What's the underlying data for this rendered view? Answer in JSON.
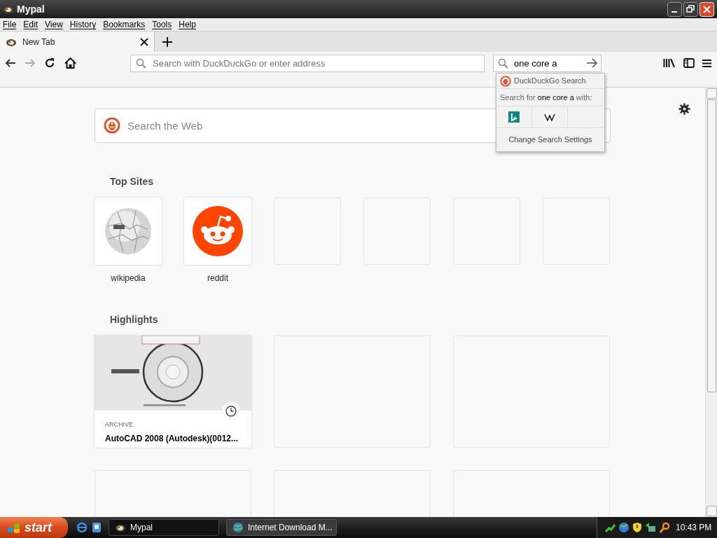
{
  "window": {
    "title": "Mypal"
  },
  "menu": [
    "File",
    "Edit",
    "View",
    "History",
    "Bookmarks",
    "Tools",
    "Help"
  ],
  "tabs": [
    {
      "label": "New Tab",
      "selected": true
    }
  ],
  "toolbar": {
    "back_disabled": false,
    "forward_disabled": true,
    "address_placeholder": "Search with DuckDuckGo or enter address",
    "search_value": "one core a"
  },
  "search_popup": {
    "engine": "DuckDuckGo Search",
    "prompt_before": "Search for ",
    "query": "one core a",
    "prompt_after": " with:",
    "engines": [
      {
        "kind": "bing"
      },
      {
        "kind": "wikipedia"
      }
    ],
    "settings": "Change Search Settings"
  },
  "new_tab": {
    "search_placeholder": "Search the Web",
    "top_sites_heading": "Top Sites",
    "top_sites": [
      {
        "kind": "wikipedia",
        "label": "wikipedia"
      },
      {
        "kind": "reddit",
        "label": "reddit"
      },
      {
        "kind": "empty"
      },
      {
        "kind": "empty"
      },
      {
        "kind": "empty"
      },
      {
        "kind": "empty"
      }
    ],
    "highlights_heading": "Highlights",
    "highlights": [
      {
        "kind": "picture",
        "type": "ARCHIVE",
        "title": "AutoCAD 2008 (Autodesk)(0012..."
      },
      {
        "kind": "empty"
      },
      {
        "kind": "empty"
      },
      {
        "kind": "empty"
      },
      {
        "kind": "empty"
      },
      {
        "kind": "empty"
      }
    ]
  },
  "taskbar": {
    "start": "start",
    "buttons": [
      {
        "label": "Mypal",
        "selected": true
      },
      {
        "label": "Internet Download M...",
        "selected": false
      }
    ],
    "clock": "10:43 PM"
  }
}
